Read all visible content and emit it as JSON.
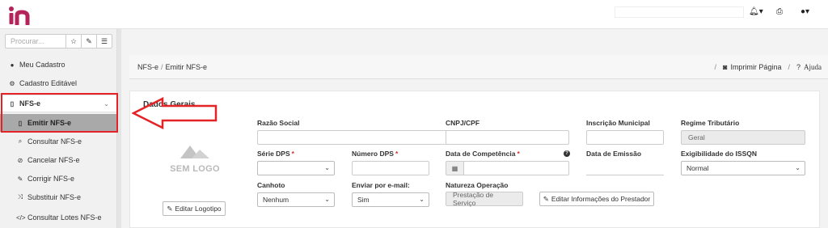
{
  "topbar": {
    "icons": [
      "bell-icon",
      "caret-down-icon",
      "print-icon",
      "user-icon",
      "caret-down-icon"
    ]
  },
  "sidebar": {
    "search_placeholder": "Procurar...",
    "search_buttons": [
      "star-icon",
      "pencil-icon",
      "list-icon"
    ],
    "items": [
      {
        "label": "Meu Cadastro",
        "icon": "user-icon"
      },
      {
        "label": "Cadastro Editável",
        "icon": "cogs-icon"
      },
      {
        "label": "NFS-e",
        "icon": "file-icon"
      },
      {
        "label": "Emitir NFS-e",
        "icon": "file-icon"
      },
      {
        "label": "Consultar NFS-e",
        "icon": "search-icon"
      },
      {
        "label": "Cancelar NFS-e",
        "icon": "ban-icon"
      },
      {
        "label": "Corrigir NFS-e",
        "icon": "edit-icon"
      },
      {
        "label": "Substituir NFS-e",
        "icon": "shuffle-icon"
      },
      {
        "label": "Consultar Lotes NFS-e",
        "icon": "code-icon"
      }
    ]
  },
  "breadcrumb": {
    "items": [
      "NFS-e",
      "Emitir NFS-e"
    ],
    "separator": "/",
    "actions": [
      "Imprimir Página",
      "Ajuda"
    ]
  },
  "panel": {
    "title": "Dados Gerais",
    "logo_text": "SEM LOGO",
    "edit_logo_button": "Editar Logotipo",
    "edit_provider_button": "Editar Informações do Prestador"
  },
  "fields": {
    "razao_social": {
      "label": "Razão Social",
      "value": ""
    },
    "cnpj_cpf": {
      "label": "CNPJ/CPF",
      "value": ""
    },
    "inscricao_municipal": {
      "label": "Inscrição Municipal",
      "value": ""
    },
    "regime_tributario": {
      "label": "Regime Tributário",
      "value": "Geral"
    },
    "serie_dps": {
      "label": "Série DPS",
      "value": "",
      "required": "*"
    },
    "numero_dps": {
      "label": "Número DPS",
      "value": "",
      "required": "*"
    },
    "data_competencia": {
      "label": "Data de Competência",
      "value": "",
      "required": "*"
    },
    "data_emissao": {
      "label": "Data de Emissão",
      "value": ""
    },
    "exigibilidade_issqn": {
      "label": "Exigibilidade do ISSQN",
      "value": "Normal"
    },
    "canhoto": {
      "label": "Canhoto",
      "value": "Nenhum"
    },
    "enviar_email": {
      "label": "Enviar por e-mail:",
      "value": "Sim"
    },
    "natureza_operacao": {
      "label": "Natureza Operação",
      "value": "Prestação de Serviço"
    }
  },
  "colors": {
    "brand": "#b5235b",
    "highlight_border": "#e52327",
    "active_item_bg": "#a9a9a9"
  }
}
